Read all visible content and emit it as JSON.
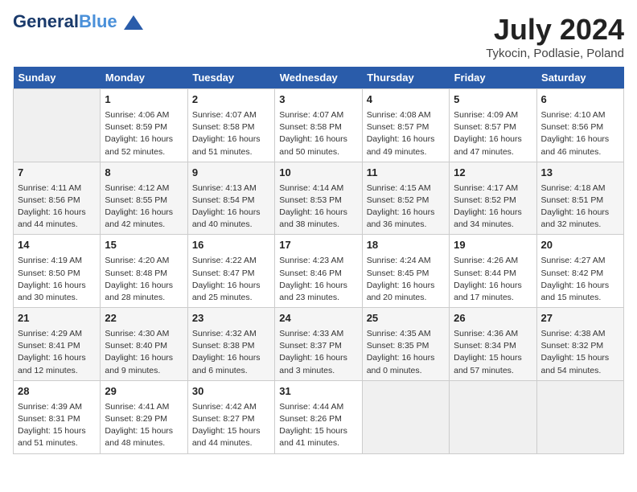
{
  "header": {
    "logo_main": "General",
    "logo_accent": "Blue",
    "month_year": "July 2024",
    "location": "Tykocin, Podlasie, Poland"
  },
  "days_of_week": [
    "Sunday",
    "Monday",
    "Tuesday",
    "Wednesday",
    "Thursday",
    "Friday",
    "Saturday"
  ],
  "weeks": [
    [
      {
        "day": "",
        "empty": true
      },
      {
        "day": "1",
        "sunrise": "Sunrise: 4:06 AM",
        "sunset": "Sunset: 8:59 PM",
        "daylight": "Daylight: 16 hours and 52 minutes."
      },
      {
        "day": "2",
        "sunrise": "Sunrise: 4:07 AM",
        "sunset": "Sunset: 8:58 PM",
        "daylight": "Daylight: 16 hours and 51 minutes."
      },
      {
        "day": "3",
        "sunrise": "Sunrise: 4:07 AM",
        "sunset": "Sunset: 8:58 PM",
        "daylight": "Daylight: 16 hours and 50 minutes."
      },
      {
        "day": "4",
        "sunrise": "Sunrise: 4:08 AM",
        "sunset": "Sunset: 8:57 PM",
        "daylight": "Daylight: 16 hours and 49 minutes."
      },
      {
        "day": "5",
        "sunrise": "Sunrise: 4:09 AM",
        "sunset": "Sunset: 8:57 PM",
        "daylight": "Daylight: 16 hours and 47 minutes."
      },
      {
        "day": "6",
        "sunrise": "Sunrise: 4:10 AM",
        "sunset": "Sunset: 8:56 PM",
        "daylight": "Daylight: 16 hours and 46 minutes."
      }
    ],
    [
      {
        "day": "7",
        "sunrise": "Sunrise: 4:11 AM",
        "sunset": "Sunset: 8:56 PM",
        "daylight": "Daylight: 16 hours and 44 minutes."
      },
      {
        "day": "8",
        "sunrise": "Sunrise: 4:12 AM",
        "sunset": "Sunset: 8:55 PM",
        "daylight": "Daylight: 16 hours and 42 minutes."
      },
      {
        "day": "9",
        "sunrise": "Sunrise: 4:13 AM",
        "sunset": "Sunset: 8:54 PM",
        "daylight": "Daylight: 16 hours and 40 minutes."
      },
      {
        "day": "10",
        "sunrise": "Sunrise: 4:14 AM",
        "sunset": "Sunset: 8:53 PM",
        "daylight": "Daylight: 16 hours and 38 minutes."
      },
      {
        "day": "11",
        "sunrise": "Sunrise: 4:15 AM",
        "sunset": "Sunset: 8:52 PM",
        "daylight": "Daylight: 16 hours and 36 minutes."
      },
      {
        "day": "12",
        "sunrise": "Sunrise: 4:17 AM",
        "sunset": "Sunset: 8:52 PM",
        "daylight": "Daylight: 16 hours and 34 minutes."
      },
      {
        "day": "13",
        "sunrise": "Sunrise: 4:18 AM",
        "sunset": "Sunset: 8:51 PM",
        "daylight": "Daylight: 16 hours and 32 minutes."
      }
    ],
    [
      {
        "day": "14",
        "sunrise": "Sunrise: 4:19 AM",
        "sunset": "Sunset: 8:50 PM",
        "daylight": "Daylight: 16 hours and 30 minutes."
      },
      {
        "day": "15",
        "sunrise": "Sunrise: 4:20 AM",
        "sunset": "Sunset: 8:48 PM",
        "daylight": "Daylight: 16 hours and 28 minutes."
      },
      {
        "day": "16",
        "sunrise": "Sunrise: 4:22 AM",
        "sunset": "Sunset: 8:47 PM",
        "daylight": "Daylight: 16 hours and 25 minutes."
      },
      {
        "day": "17",
        "sunrise": "Sunrise: 4:23 AM",
        "sunset": "Sunset: 8:46 PM",
        "daylight": "Daylight: 16 hours and 23 minutes."
      },
      {
        "day": "18",
        "sunrise": "Sunrise: 4:24 AM",
        "sunset": "Sunset: 8:45 PM",
        "daylight": "Daylight: 16 hours and 20 minutes."
      },
      {
        "day": "19",
        "sunrise": "Sunrise: 4:26 AM",
        "sunset": "Sunset: 8:44 PM",
        "daylight": "Daylight: 16 hours and 17 minutes."
      },
      {
        "day": "20",
        "sunrise": "Sunrise: 4:27 AM",
        "sunset": "Sunset: 8:42 PM",
        "daylight": "Daylight: 16 hours and 15 minutes."
      }
    ],
    [
      {
        "day": "21",
        "sunrise": "Sunrise: 4:29 AM",
        "sunset": "Sunset: 8:41 PM",
        "daylight": "Daylight: 16 hours and 12 minutes."
      },
      {
        "day": "22",
        "sunrise": "Sunrise: 4:30 AM",
        "sunset": "Sunset: 8:40 PM",
        "daylight": "Daylight: 16 hours and 9 minutes."
      },
      {
        "day": "23",
        "sunrise": "Sunrise: 4:32 AM",
        "sunset": "Sunset: 8:38 PM",
        "daylight": "Daylight: 16 hours and 6 minutes."
      },
      {
        "day": "24",
        "sunrise": "Sunrise: 4:33 AM",
        "sunset": "Sunset: 8:37 PM",
        "daylight": "Daylight: 16 hours and 3 minutes."
      },
      {
        "day": "25",
        "sunrise": "Sunrise: 4:35 AM",
        "sunset": "Sunset: 8:35 PM",
        "daylight": "Daylight: 16 hours and 0 minutes."
      },
      {
        "day": "26",
        "sunrise": "Sunrise: 4:36 AM",
        "sunset": "Sunset: 8:34 PM",
        "daylight": "Daylight: 15 hours and 57 minutes."
      },
      {
        "day": "27",
        "sunrise": "Sunrise: 4:38 AM",
        "sunset": "Sunset: 8:32 PM",
        "daylight": "Daylight: 15 hours and 54 minutes."
      }
    ],
    [
      {
        "day": "28",
        "sunrise": "Sunrise: 4:39 AM",
        "sunset": "Sunset: 8:31 PM",
        "daylight": "Daylight: 15 hours and 51 minutes."
      },
      {
        "day": "29",
        "sunrise": "Sunrise: 4:41 AM",
        "sunset": "Sunset: 8:29 PM",
        "daylight": "Daylight: 15 hours and 48 minutes."
      },
      {
        "day": "30",
        "sunrise": "Sunrise: 4:42 AM",
        "sunset": "Sunset: 8:27 PM",
        "daylight": "Daylight: 15 hours and 44 minutes."
      },
      {
        "day": "31",
        "sunrise": "Sunrise: 4:44 AM",
        "sunset": "Sunset: 8:26 PM",
        "daylight": "Daylight: 15 hours and 41 minutes."
      },
      {
        "day": "",
        "empty": true
      },
      {
        "day": "",
        "empty": true
      },
      {
        "day": "",
        "empty": true
      }
    ]
  ]
}
